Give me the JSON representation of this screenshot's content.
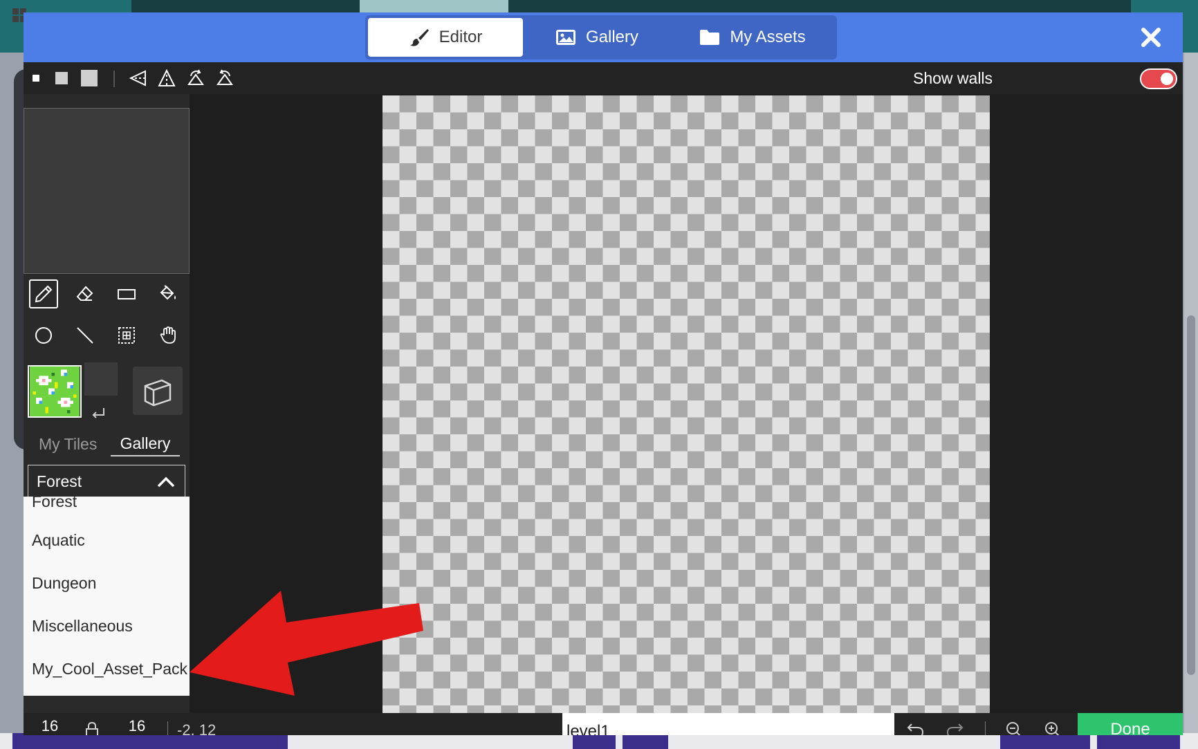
{
  "header": {
    "tabs": [
      {
        "label": "Editor",
        "icon": "paintbrush-icon",
        "active": true
      },
      {
        "label": "Gallery",
        "icon": "image-icon",
        "active": false
      },
      {
        "label": "My Assets",
        "icon": "folder-icon",
        "active": false
      }
    ],
    "close_icon": "close-icon"
  },
  "toolbar": {
    "brush_sizes": [
      "small",
      "medium",
      "large"
    ],
    "symmetry_tools": [
      "mirror-horizontal-icon",
      "mirror-vertical-icon",
      "rotate-icon",
      "flip-icon"
    ],
    "show_walls_label": "Show walls",
    "show_walls_on": true
  },
  "tools": {
    "items": [
      "pencil",
      "eraser",
      "rectangle",
      "fill",
      "circle",
      "line",
      "marquee",
      "pan"
    ],
    "active": "pencil"
  },
  "tile_panel": {
    "tabs": [
      {
        "label": "My Tiles",
        "active": false
      },
      {
        "label": "Gallery",
        "active": true
      }
    ],
    "dropdown": {
      "selected": "Forest",
      "options": [
        "Forest",
        "Aquatic",
        "Dungeon",
        "Miscellaneous",
        "My_Cool_Asset_Pack"
      ]
    }
  },
  "bottom_bar": {
    "width": "16",
    "height": "16",
    "coords": "-2, 12",
    "level_name": "level1",
    "done_label": "Done"
  },
  "colors": {
    "header_blue": "#4d7ee8",
    "done_green": "#2ec46e",
    "toggle_red": "#e5484d",
    "annotation_red": "#e31b1b"
  }
}
